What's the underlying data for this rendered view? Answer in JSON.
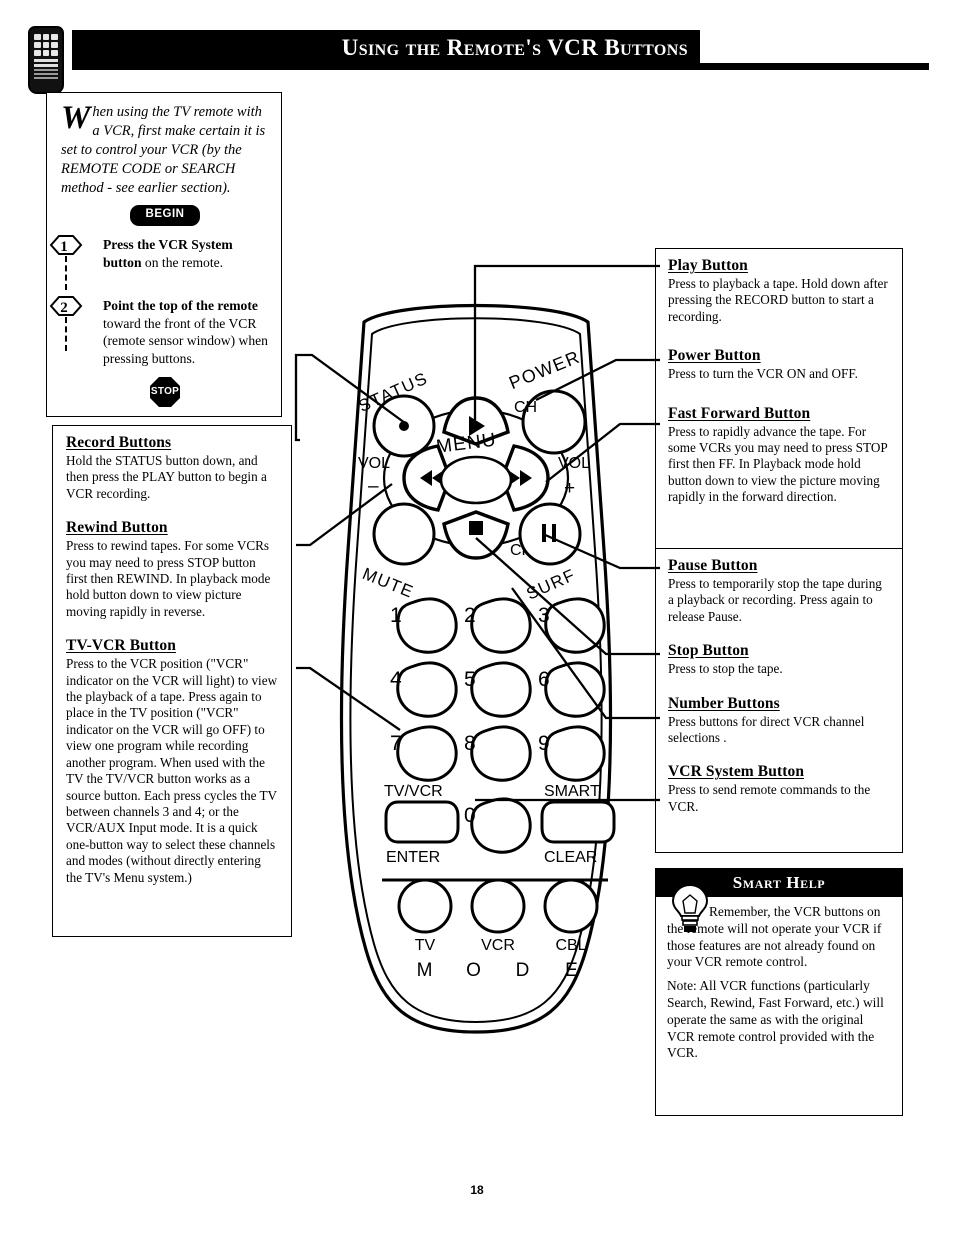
{
  "header": {
    "title": "Using the Remote's VCR Buttons",
    "icon": "remote-control-icon"
  },
  "intro": {
    "dropcap": "W",
    "paragraph": "hen using the TV remote with a VCR, first make certain it is set to control your VCR (by the REMOTE CODE or SEARCH method - see earlier section).",
    "begin_badge": "BEGIN",
    "stop_badge": "STOP",
    "steps": [
      {
        "number": "1",
        "bold": "Press the VCR System button",
        "rest": " on the remote."
      },
      {
        "number": "2",
        "bold": "Point the top of the remote",
        "rest": " toward the front of the VCR (remote sensor window) when pressing buttons."
      }
    ]
  },
  "left_sections": [
    {
      "title": "Record Buttons",
      "body": "Hold the STATUS button down, and then press the PLAY button to begin a VCR recording."
    },
    {
      "title": "Rewind Button",
      "body": "Press to rewind tapes. For some VCRs you may need to press STOP button first then REWIND. In playback mode hold button down to view picture moving rapidly in reverse."
    },
    {
      "title": "TV-VCR Button",
      "body": "Press to the VCR position (\"VCR\" indicator on the VCR will light) to view the playback of a tape. Press again to place in the TV position (\"VCR\" indicator on the VCR will go OFF) to view one program while recording another program. When used with the TV the TV/VCR button works as a source button. Each press cycles the TV between channels 3 and 4; or the VCR/AUX Input mode. It is a quick one-button way to select these channels and modes (without directly entering the TV's Menu system.)"
    }
  ],
  "right_top_sections": [
    {
      "title": "Play Button",
      "body": "Press to playback a tape. Hold down after pressing the RECORD button to start a recording."
    },
    {
      "title": "Power Button",
      "body": "Press to turn the VCR ON and OFF."
    },
    {
      "title": "Fast Forward Button",
      "body": "Press to rapidly advance the tape. For some VCRs you may need to press STOP first then FF. In Playback mode hold button down to view the picture moving rapidly in the forward direction."
    }
  ],
  "right_bottom_sections": [
    {
      "title": "Pause Button",
      "body": "Press to temporarily stop the tape during a playback or recording. Press again to release Pause."
    },
    {
      "title": "Stop Button",
      "body": "Press to stop the tape."
    },
    {
      "title": "Number Buttons",
      "body": "Press buttons for direct VCR channel selections ."
    },
    {
      "title": "VCR System Button",
      "body": "Press to send remote commands to the VCR."
    }
  ],
  "smart_help": {
    "title": "Smart Help",
    "icon": "lightbulb-icon",
    "paragraph1": "Remember, the VCR buttons on the remote will not operate your VCR if those features are not already found on your VCR remote control.",
    "paragraph2": "Note: All VCR functions (particularly Search, Rewind, Fast Forward, etc.) will operate the same as with the original VCR remote control provided with the VCR."
  },
  "remote": {
    "labels": {
      "status": "STATUS",
      "ch_up": "CH",
      "ch_down": "CH",
      "power": "POWER",
      "menu": "MENU",
      "vol_left": "VOL",
      "vol_left_sign": "–",
      "vol_right": "VOL",
      "vol_right_sign": "+",
      "mute": "MUTE",
      "surf": "SURF"
    },
    "numbers": [
      "1",
      "2",
      "3",
      "4",
      "5",
      "6",
      "7",
      "8",
      "9"
    ],
    "zero": "0",
    "tvvcr": "TV/VCR",
    "enter": "ENTER",
    "smart": "SMART",
    "clear": "CLEAR",
    "mode_buttons": [
      "TV",
      "VCR",
      "CBL"
    ],
    "mode_word": [
      "M",
      "O",
      "D",
      "E"
    ]
  },
  "page_number": "18",
  "colors": {
    "ink": "#000000",
    "paper": "#ffffff"
  }
}
